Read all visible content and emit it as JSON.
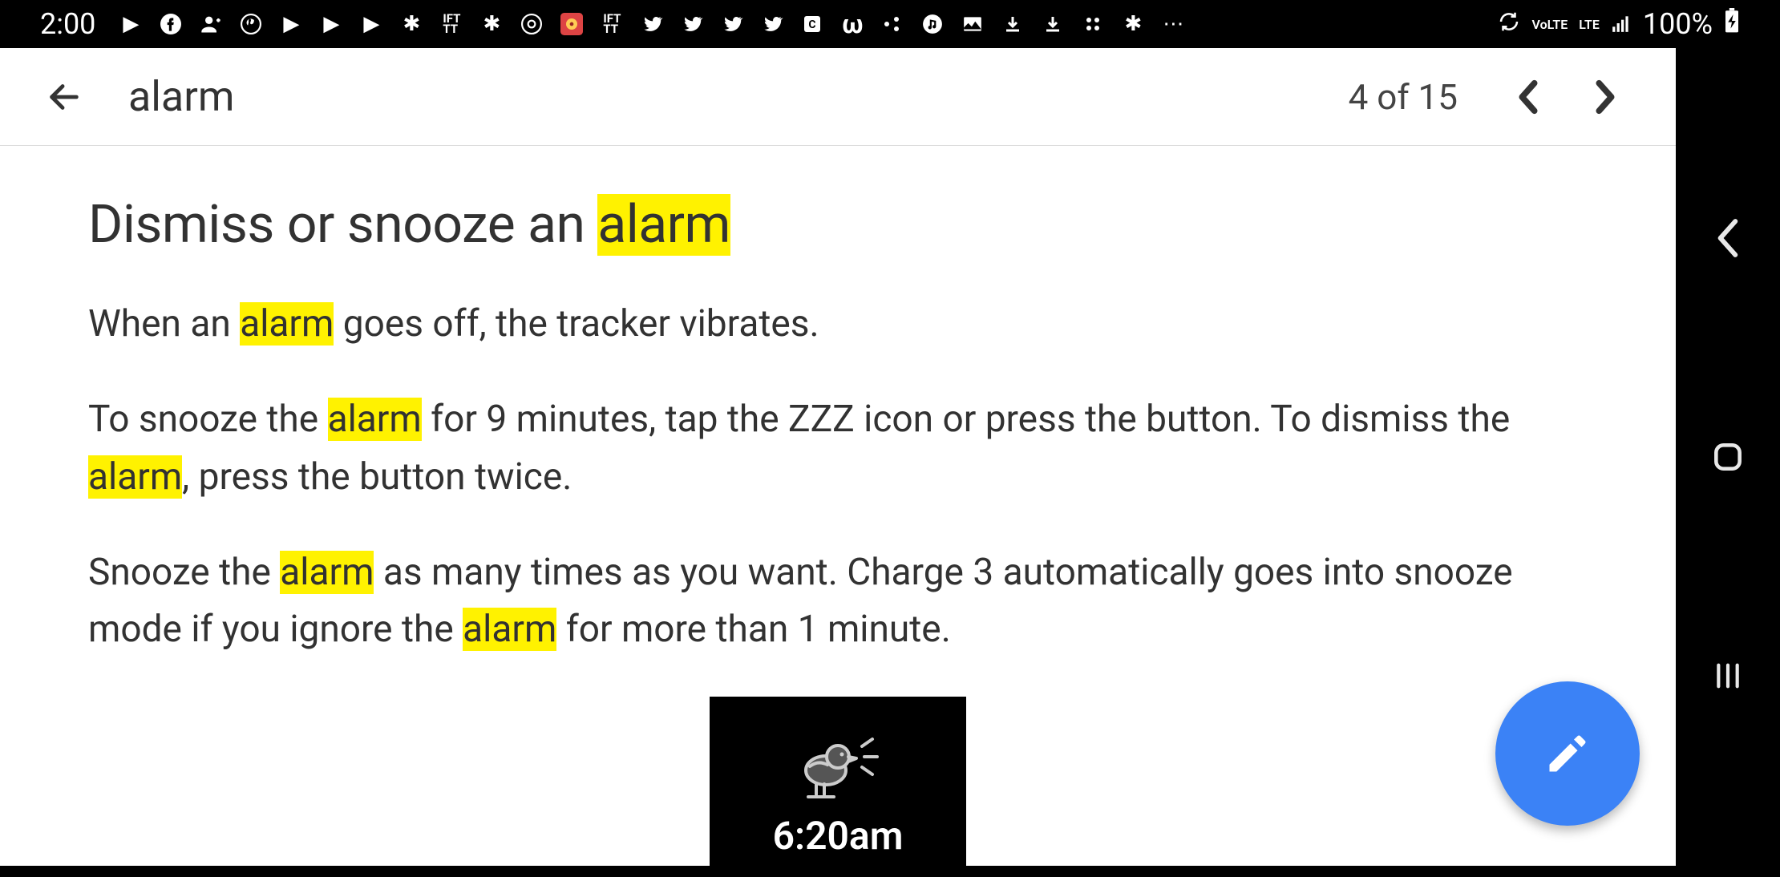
{
  "status_bar": {
    "time": "2:00",
    "volte_label": "VoLTE",
    "lte_label": "LTE",
    "battery_pct": "100%",
    "icons": [
      "youtube",
      "facebook",
      "person-add",
      "pinterest",
      "youtube",
      "youtube",
      "youtube",
      "ifttt",
      "ift-tt",
      "ifttt",
      "chrome",
      "flower",
      "ift-tt",
      "twitter",
      "twitter",
      "twitter",
      "twitter",
      "app",
      "wattpad",
      "share",
      "music",
      "photo",
      "download",
      "download",
      "apps",
      "ifttt",
      "more"
    ]
  },
  "find_bar": {
    "query": "alarm",
    "result_position": "4 of 15"
  },
  "content": {
    "heading_pre": "Dismiss or snooze an ",
    "heading_hl": "alarm",
    "p1_pre": "When an ",
    "p1_hl1": "alarm",
    "p1_post": " goes off, the tracker vibrates.",
    "p2_a": "To snooze the ",
    "p2_hl1": "alarm",
    "p2_b": " for 9 minutes, tap the ZZZ icon or press the button. To dismiss the ",
    "p2_hl2": "alarm",
    "p2_c": ", press the button twice.",
    "p3_a": "Snooze the ",
    "p3_hl1": "alarm",
    "p3_b": " as many times as you want. Charge 3 automatically goes into snooze mode if you ignore the ",
    "p3_hl2": "alarm",
    "p3_c": " for more than 1 minute."
  },
  "device": {
    "alarm_time": "6:20am"
  },
  "colors": {
    "highlight": "#fff200",
    "fab": "#3b82f6"
  }
}
